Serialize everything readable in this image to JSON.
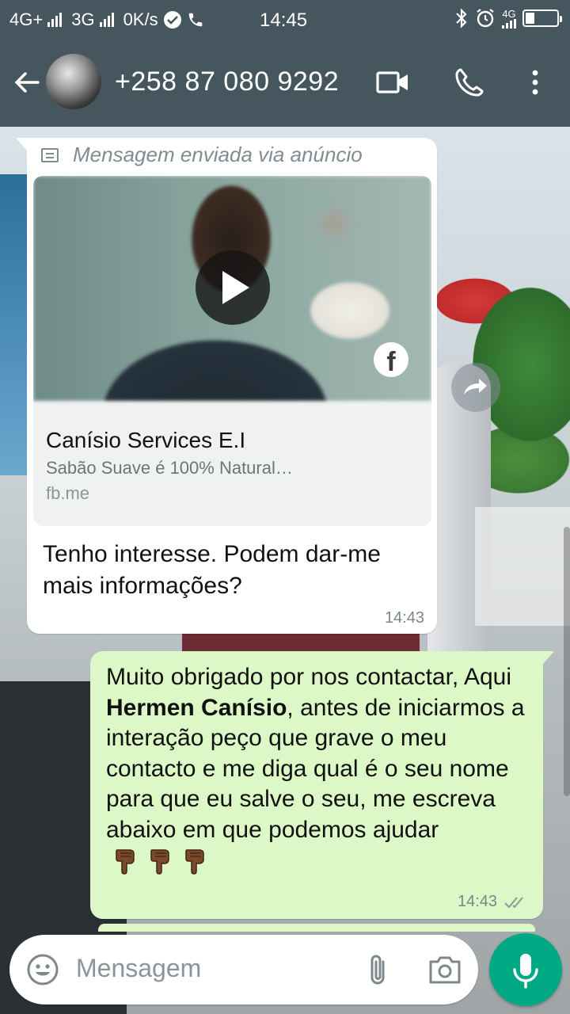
{
  "status_bar": {
    "network_1": "4G+",
    "network_2": "3G",
    "speed": "0K/s",
    "time": "14:45",
    "network_3": "4G"
  },
  "header": {
    "contact": "+258 87 080 9292",
    "icons": [
      "back-arrow-icon",
      "avatar",
      "video-call-icon",
      "phone-icon",
      "more-vert-icon"
    ]
  },
  "incoming": {
    "ad_notice": "Mensagem enviada via anúncio",
    "card": {
      "title": "Canísio Services E.I",
      "description": "Sabão Suave é 100% Natural…",
      "link": "fb.me",
      "badge_icon": "facebook-icon"
    },
    "text": "Tenho interesse. Podem dar-me mais informações?",
    "time": "14:43"
  },
  "outgoing": {
    "text_before": "Muito obrigado por nos contactar, Aqui ",
    "bold_name": "Hermen Canísio",
    "text_after": ", antes de iniciarmos a interação peço que grave o meu contacto e me diga qual é o seu nome para que eu salve o seu, me escreva abaixo em que podemos ajudar ",
    "emoji_icons": [
      "pointing-down-hand-icon",
      "pointing-down-hand-icon",
      "pointing-down-hand-icon"
    ],
    "time": "14:43",
    "status": "read"
  },
  "composer": {
    "placeholder": "Mensagem"
  },
  "colors": {
    "header": "#46565f",
    "outgoing_bubble": "#dcf8c6",
    "incoming_bubble": "#ffffff",
    "accent": "#00a884"
  }
}
